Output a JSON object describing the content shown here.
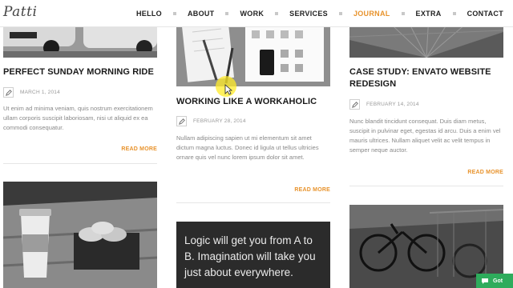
{
  "header": {
    "logo_text": "Patti",
    "nav": [
      {
        "label": "HELLO",
        "active": false
      },
      {
        "label": "ABOUT",
        "active": false
      },
      {
        "label": "WORK",
        "active": false
      },
      {
        "label": "SERVICES",
        "active": false
      },
      {
        "label": "JOURNAL",
        "active": true
      },
      {
        "label": "EXTRA",
        "active": false
      },
      {
        "label": "CONTACT",
        "active": false
      }
    ]
  },
  "posts": {
    "p1": {
      "title": "PERFECT SUNDAY MORNING RIDE",
      "date": "MARCH 1, 2014",
      "excerpt": "Ut enim ad minima veniam, quis nostrum exercitationem ullam corporis suscipit laboriosam, nisi ut aliquid ex ea commodi consequatur.",
      "read_more": "READ MORE"
    },
    "p2": {
      "title": "WORKING LIKE A WORKAHOLIC",
      "date": "FEBRUARY 28, 2014",
      "excerpt": "Nullam adipiscing sapien ut mi elementum sit amet dictum magna luctus. Donec id ligula ut tellus ultricies ornare quis vel nunc lorem ipsum dolor sit amet.",
      "read_more": "READ MORE"
    },
    "p3": {
      "title": "CASE STUDY: ENVATO WEBSITE REDESIGN",
      "date": "FEBRUARY 14, 2014",
      "excerpt": "Nunc blandit tincidunt consequat. Duis diam metus, suscipit in pulvinar eget, egestas id arcu. Duis a enim vel mauris ultrices. Nullam aliquet velit ac velit tempus in semper neque auctor.",
      "read_more": "READ MORE"
    },
    "quote": {
      "text": "Logic will get you from A to B. Imagination will take you just about everywhere."
    }
  },
  "chat": {
    "label": "Got"
  },
  "colors": {
    "accent": "#e8932c",
    "heading": "#1a1a1a",
    "muted_text": "#888888",
    "quote_bg": "#2b2b2b",
    "chat_bg": "#2eac5c"
  },
  "icons": {
    "post_format": "pencil-icon",
    "chat": "chat-bubble-icon"
  }
}
